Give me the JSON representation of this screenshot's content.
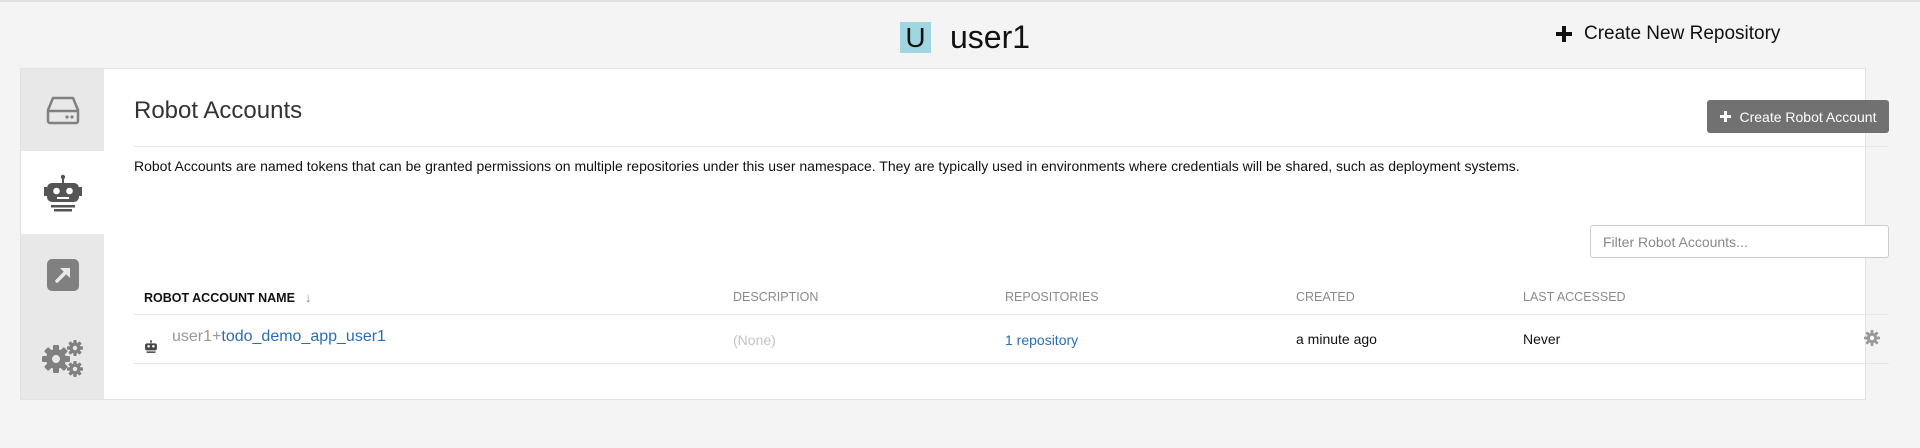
{
  "header": {
    "avatar_letter": "U",
    "username": "user1",
    "create_repo_label": "Create New Repository"
  },
  "sidebar": {
    "tabs": [
      {
        "icon": "hdd-icon",
        "active": false
      },
      {
        "icon": "robot-icon",
        "active": true
      },
      {
        "icon": "external-link-icon",
        "active": false
      },
      {
        "icon": "gears-icon",
        "active": false
      }
    ]
  },
  "main": {
    "title": "Robot Accounts",
    "create_robot_label": "Create Robot Account",
    "description": "Robot Accounts are named tokens that can be granted permissions on multiple repositories under this user namespace. They are typically used in environments where credentials will be shared, such as deployment systems.",
    "filter_placeholder": "Filter Robot Accounts...",
    "columns": {
      "name": "Robot Account Name",
      "description": "Description",
      "repositories": "Repositories",
      "created": "Created",
      "last_accessed": "Last Accessed"
    },
    "rows": [
      {
        "name_prefix": "user1+",
        "name": "todo_demo_app_user1",
        "description": "(None)",
        "repositories": "1 repository",
        "created": "a minute ago",
        "last_accessed": "Never"
      }
    ]
  },
  "colors": {
    "avatar_bg": "#9fd6e2",
    "button_bg": "#717171",
    "link": "#2a6db5",
    "sidebar_bg": "#e8e8e8"
  }
}
